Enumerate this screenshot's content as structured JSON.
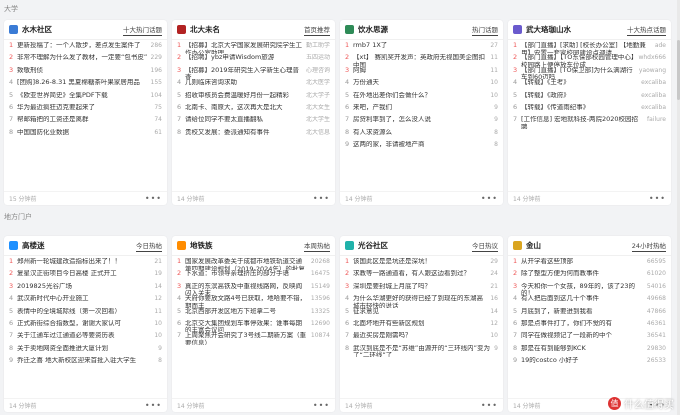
{
  "sections": {
    "top_label": "大学",
    "bottom_label": "地方门户"
  },
  "cards": [
    {
      "site": "水木社区",
      "logo_color": "#3a7bd5",
      "tab": "十大热门话题",
      "items": [
        {
          "rank": "1",
          "title": "更新投稿了：一个人散步，差点发生案件了",
          "value": "286"
        },
        {
          "rank": "2",
          "title": "非常不理解为什么发了教材，一定要“包书皮”",
          "value": "229"
        },
        {
          "rank": "3",
          "title": "致敬刑侦",
          "value": "196"
        },
        {
          "rank": "4",
          "title": "[团购]8.26-8.31 黑夏棉糖茶叶果家居用品",
          "value": "155"
        },
        {
          "rank": "5",
          "title": "《欧亚世界简史》全集PDF下载",
          "value": "104"
        },
        {
          "rank": "6",
          "title": "华为最近疯狂迈克要起来了",
          "value": "75"
        },
        {
          "rank": "7",
          "title": "帮邮箱把的工资还是离群",
          "value": "74"
        },
        {
          "rank": "8",
          "title": "中国国防化业数据",
          "value": "61"
        }
      ],
      "updated": "15 分钟前",
      "more": "•••"
    },
    {
      "site": "北大未名",
      "logo_color": "#b22222",
      "tab": "首页推荐",
      "items": [
        {
          "rank": "1",
          "title": "【招募】北京大学国家发展研究院学生工作办公室助理",
          "value": "勤工助学"
        },
        {
          "rank": "2",
          "title": "【招聘】ybz申请Wisdom旅游",
          "value": "五四运动"
        },
        {
          "rank": "3",
          "title": "【招募】2019年研究生入学新生心理普查",
          "value": "心理咨询"
        },
        {
          "rank": "4",
          "title": "几则临床咨询求助",
          "value": "北大医学"
        },
        {
          "rank": "5",
          "title": "招收审核员会费温暖好月份一起精彩",
          "value": "北大学子"
        },
        {
          "rank": "6",
          "title": "北南卡、南原大，这次再大是北大",
          "value": "北大女生"
        },
        {
          "rank": "7",
          "title": "请给位同学不要太直播翻私",
          "value": "北大学生"
        },
        {
          "rank": "8",
          "title": "贵校又发展：委派通知有事件",
          "value": "北大信息"
        }
      ],
      "updated": "14 分钟前",
      "more": "•••"
    },
    {
      "site": "饮水思源",
      "logo_color": "#2e8b57",
      "tab": "热门话题",
      "items": [
        {
          "rank": "1",
          "title": "rmb7 1X了",
          "value": "27"
        },
        {
          "rank": "2",
          "title": "【xt】 赛凯奖开发声：英政府无视国美企图扣中国",
          "value": "11"
        },
        {
          "rank": "3",
          "title": "阿姆",
          "value": "11"
        },
        {
          "rank": "4",
          "title": "万份通天",
          "value": "10"
        },
        {
          "rank": "5",
          "title": "在外地出差你们会做什么？",
          "value": "10"
        },
        {
          "rank": "6",
          "title": "来吧，产我们",
          "value": "9"
        },
        {
          "rank": "7",
          "title": "房贷利率到了，怎么没人说",
          "value": "9"
        },
        {
          "rank": "8",
          "title": "有人求资源么",
          "value": "8"
        },
        {
          "rank": "9",
          "title": "这两的家，非请被地产商",
          "value": "8"
        }
      ],
      "updated": "14 分钟前",
      "more": "•••"
    },
    {
      "site": "武大珞珈山水",
      "logo_color": "#6a5acd",
      "tab": "十大热点话题",
      "items": [
        {
          "rank": "1",
          "title": "【部门直播】[求助] [校长办公室] 【地勤兼用】安置一套家校园建设点调请",
          "value": "ade"
        },
        {
          "rank": "2",
          "title": "【部门直播】【TO东保部校园管理中心】校园路上便停放车位成",
          "value": "whdx666"
        },
        {
          "rank": "3",
          "title": "【部门直播】[TO保卫部]为什么满湖行车到60迈吗",
          "value": "yaowang"
        },
        {
          "rank": "4",
          "title": "【转载】《王考》",
          "value": "excaliba"
        },
        {
          "rank": "5",
          "title": "【转载】《政府》",
          "value": "excaliba"
        },
        {
          "rank": "6",
          "title": "【转载】《传道雨纪事》",
          "value": "excaliba"
        },
        {
          "rank": "7",
          "title": "[工作信息] 宏地就科技-两院2020校园招聘",
          "value": "failure"
        }
      ],
      "updated": "14 分钟前",
      "more": "•••"
    },
    {
      "site": "高楼迷",
      "logo_color": "#1e90ff",
      "tab": "今日热帖",
      "items": [
        {
          "rank": "1",
          "title": "郑州新一轮城建改造指标出来了！！",
          "value": "21"
        },
        {
          "rank": "2",
          "title": "复星汉正街项目今日高楼 正式开工",
          "value": "19"
        },
        {
          "rank": "3",
          "title": "2019825光谷广场",
          "value": "14"
        },
        {
          "rank": "4",
          "title": "武汉新时代中心开业施工",
          "value": "12"
        },
        {
          "rank": "5",
          "title": "表情中的全境城际线（第一次回看）",
          "value": "11"
        },
        {
          "rank": "6",
          "title": "正式新街综合指数型，谢谢大家认可",
          "value": "10"
        },
        {
          "rank": "7",
          "title": "关于江通车过江通道必等要资历表",
          "value": "10"
        },
        {
          "rank": "8",
          "title": "关于卖地网资全面推进大厦计划",
          "value": "9"
        },
        {
          "rank": "9",
          "title": "乔迁之喜 地大新校区迎来首批入驻大学生",
          "value": "8"
        }
      ],
      "updated": "14 分钟前",
      "more": "•••"
    },
    {
      "site": "地铁族",
      "logo_color": "#ff8c00",
      "tab": "本周热帖",
      "items": [
        {
          "rank": "1",
          "title": "国家发展改革委关于成都市地铁轨道交通第四期建设规划（2019-2024年）的批复",
          "value": "20268"
        },
        {
          "rank": "2",
          "title": "下水道：市领导亲理挤压的部分手语",
          "value": "16475"
        },
        {
          "rank": "3",
          "title": "真正的东滨高铁及中重视线路网，反映阎闪入关末",
          "value": "15149"
        },
        {
          "rank": "4",
          "title": "天府你要放文路4号已获取，地哈要不错，期而丰",
          "value": "13596"
        },
        {
          "rank": "5",
          "title": "北京西部开发区地方下班拿二号",
          "value": "13325"
        },
        {
          "rank": "6",
          "title": "北京交大集团规划车事停效果：谁事每期的丰富会议问",
          "value": "12690"
        },
        {
          "rank": "7",
          "title": "上周聚焦开会研究了3号线二期新方案（重要信息）",
          "value": "10874"
        }
      ],
      "updated": "14 分钟前",
      "more": "•••"
    },
    {
      "site": "光谷社区",
      "logo_color": "#20b2aa",
      "tab": "今日热议",
      "items": [
        {
          "rank": "1",
          "title": "该国此区是是坑还是深坑！",
          "value": "29"
        },
        {
          "rank": "2",
          "title": "求教等一路通道看，有人跟这边看到过？",
          "value": "24"
        },
        {
          "rank": "3",
          "title": "深圳是要封城上月底了吗？",
          "value": "21"
        },
        {
          "rank": "4",
          "title": "为什么华湖更好的获得已经了到现在的东湖高城市轻快的说话",
          "value": "16"
        },
        {
          "rank": "5",
          "title": "征求意见",
          "value": "14"
        },
        {
          "rank": "6",
          "title": "北面坏地开有些新区规划",
          "value": "12"
        },
        {
          "rank": "7",
          "title": "最近买房是刚需吗？",
          "value": "10"
        },
        {
          "rank": "8",
          "title": "武汉到底是不是“苏维”由源开的“三环线内”变为了“二环线”了",
          "value": "9"
        }
      ],
      "updated": "14 分钟前",
      "more": "•••"
    },
    {
      "site": "金山",
      "logo_color": "#daa520",
      "tab": "24小时热帖",
      "items": [
        {
          "rank": "1",
          "title": "从开学看这些顶部",
          "value": "66595"
        },
        {
          "rank": "2",
          "title": "除了整型方便为何而教事件",
          "value": "61020"
        },
        {
          "rank": "3",
          "title": "今天和你一个女孩，89年的，该了23的的！",
          "value": "54016"
        },
        {
          "rank": "4",
          "title": "有人把后面到这几十个事件",
          "value": "49668"
        },
        {
          "rank": "5",
          "title": "月底到了，新要进到我看",
          "value": "47866"
        },
        {
          "rank": "6",
          "title": "那是点事件打了，你们不觉的有",
          "value": "46361"
        },
        {
          "rank": "7",
          "title": "同学在做视频记了一段新的中个",
          "value": "36541"
        },
        {
          "rank": "8",
          "title": "那是在有到能够到KCK",
          "value": "29830"
        },
        {
          "rank": "9",
          "title": "19的costco 小好子",
          "value": "26533"
        }
      ],
      "updated": "14 分钟前",
      "more": "•••"
    }
  ],
  "watermark": {
    "badge": "值",
    "text": "什么值得买"
  }
}
